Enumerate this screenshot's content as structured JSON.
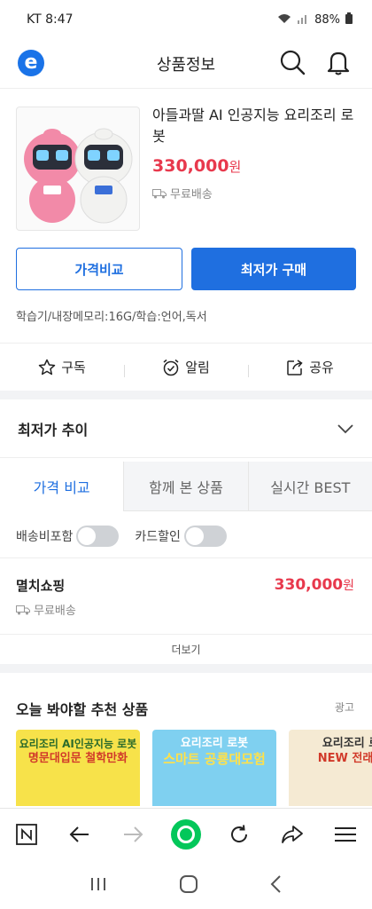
{
  "status": {
    "carrier_time": "KT 8:47",
    "battery": "88%"
  },
  "header": {
    "title": "상품정보",
    "logo_letter": "e"
  },
  "product": {
    "name": "아들과딸 AI 인공지능 요리조리 로봇",
    "price": "330,000",
    "currency": "원",
    "shipping": "무료배송"
  },
  "buttons": {
    "compare": "가격비교",
    "buy_lowest": "최저가 구매"
  },
  "spec": "학습기/내장메모리:16G/학습:언어,독서",
  "actions": {
    "subscribe": "구독",
    "alert": "알림",
    "share": "공유"
  },
  "trend": {
    "title": "최저가 추이"
  },
  "tabs": [
    "가격 비교",
    "함께 본 상품",
    "실시간 BEST"
  ],
  "toggles": {
    "shipping_included": "배송비포함",
    "card_discount": "카드할인"
  },
  "seller": {
    "name": "멸치쇼핑",
    "price": "330,000",
    "currency": "원",
    "shipping": "무료배송"
  },
  "more_label": "더보기",
  "recommend": {
    "title": "오늘 봐야할 추천 상품",
    "ad_label": "광고",
    "cards": [
      {
        "line1": "요리조리 AI인공지능 로봇",
        "line2": "명문대입문 철학만화"
      },
      {
        "line1": "요리조리 로봇",
        "line2": "스마트 공룡대모험"
      },
      {
        "line1": "요리조리 로",
        "line2": "NEW 전래동"
      }
    ]
  },
  "colors": {
    "accent": "#1f6fe0",
    "price": "#e8394d",
    "naver_green": "#03c75a"
  }
}
